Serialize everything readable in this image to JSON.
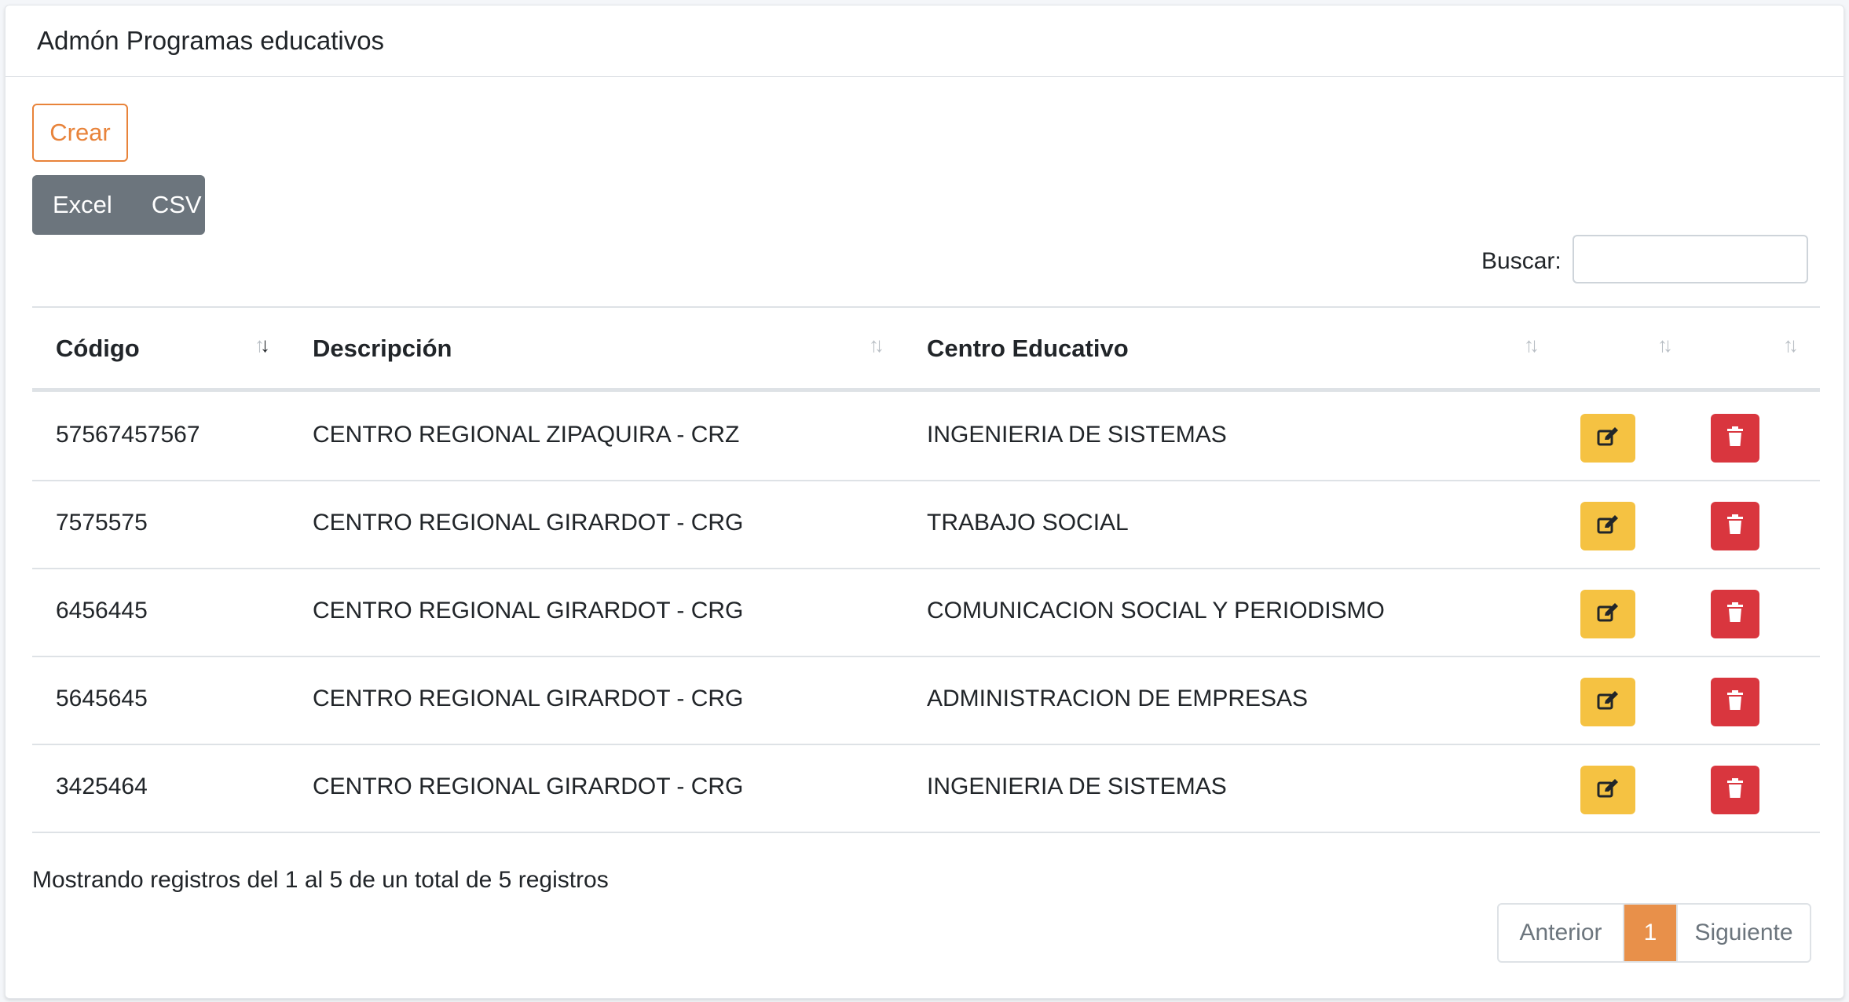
{
  "header": {
    "title": "Admón Programas educativos"
  },
  "toolbar": {
    "create_label": "Crear",
    "excel_label": "Excel",
    "csv_label": "CSV"
  },
  "search": {
    "label": "Buscar:",
    "value": ""
  },
  "table": {
    "columns": [
      "Código",
      "Descripción",
      "Centro Educativo"
    ],
    "rows": [
      {
        "codigo": "57567457567",
        "descripcion": "CENTRO REGIONAL ZIPAQUIRA - CRZ",
        "centro": "INGENIERIA DE SISTEMAS"
      },
      {
        "codigo": "7575575",
        "descripcion": "CENTRO REGIONAL GIRARDOT - CRG",
        "centro": "TRABAJO SOCIAL"
      },
      {
        "codigo": "6456445",
        "descripcion": "CENTRO REGIONAL GIRARDOT - CRG",
        "centro": "COMUNICACION SOCIAL Y PERIODISMO"
      },
      {
        "codigo": "5645645",
        "descripcion": "CENTRO REGIONAL GIRARDOT - CRG",
        "centro": "ADMINISTRACION DE EMPRESAS"
      },
      {
        "codigo": "3425464",
        "descripcion": "CENTRO REGIONAL GIRARDOT - CRG",
        "centro": "INGENIERIA DE SISTEMAS"
      }
    ]
  },
  "footer": {
    "info": "Mostrando registros del 1 al 5 de un total de 5 registros",
    "prev_label": "Anterior",
    "current_page": "1",
    "next_label": "Siguiente"
  },
  "colors": {
    "accent": "#e8833a",
    "edit": "#f5c242",
    "delete": "#d9363e",
    "secondary": "#6c757d"
  }
}
